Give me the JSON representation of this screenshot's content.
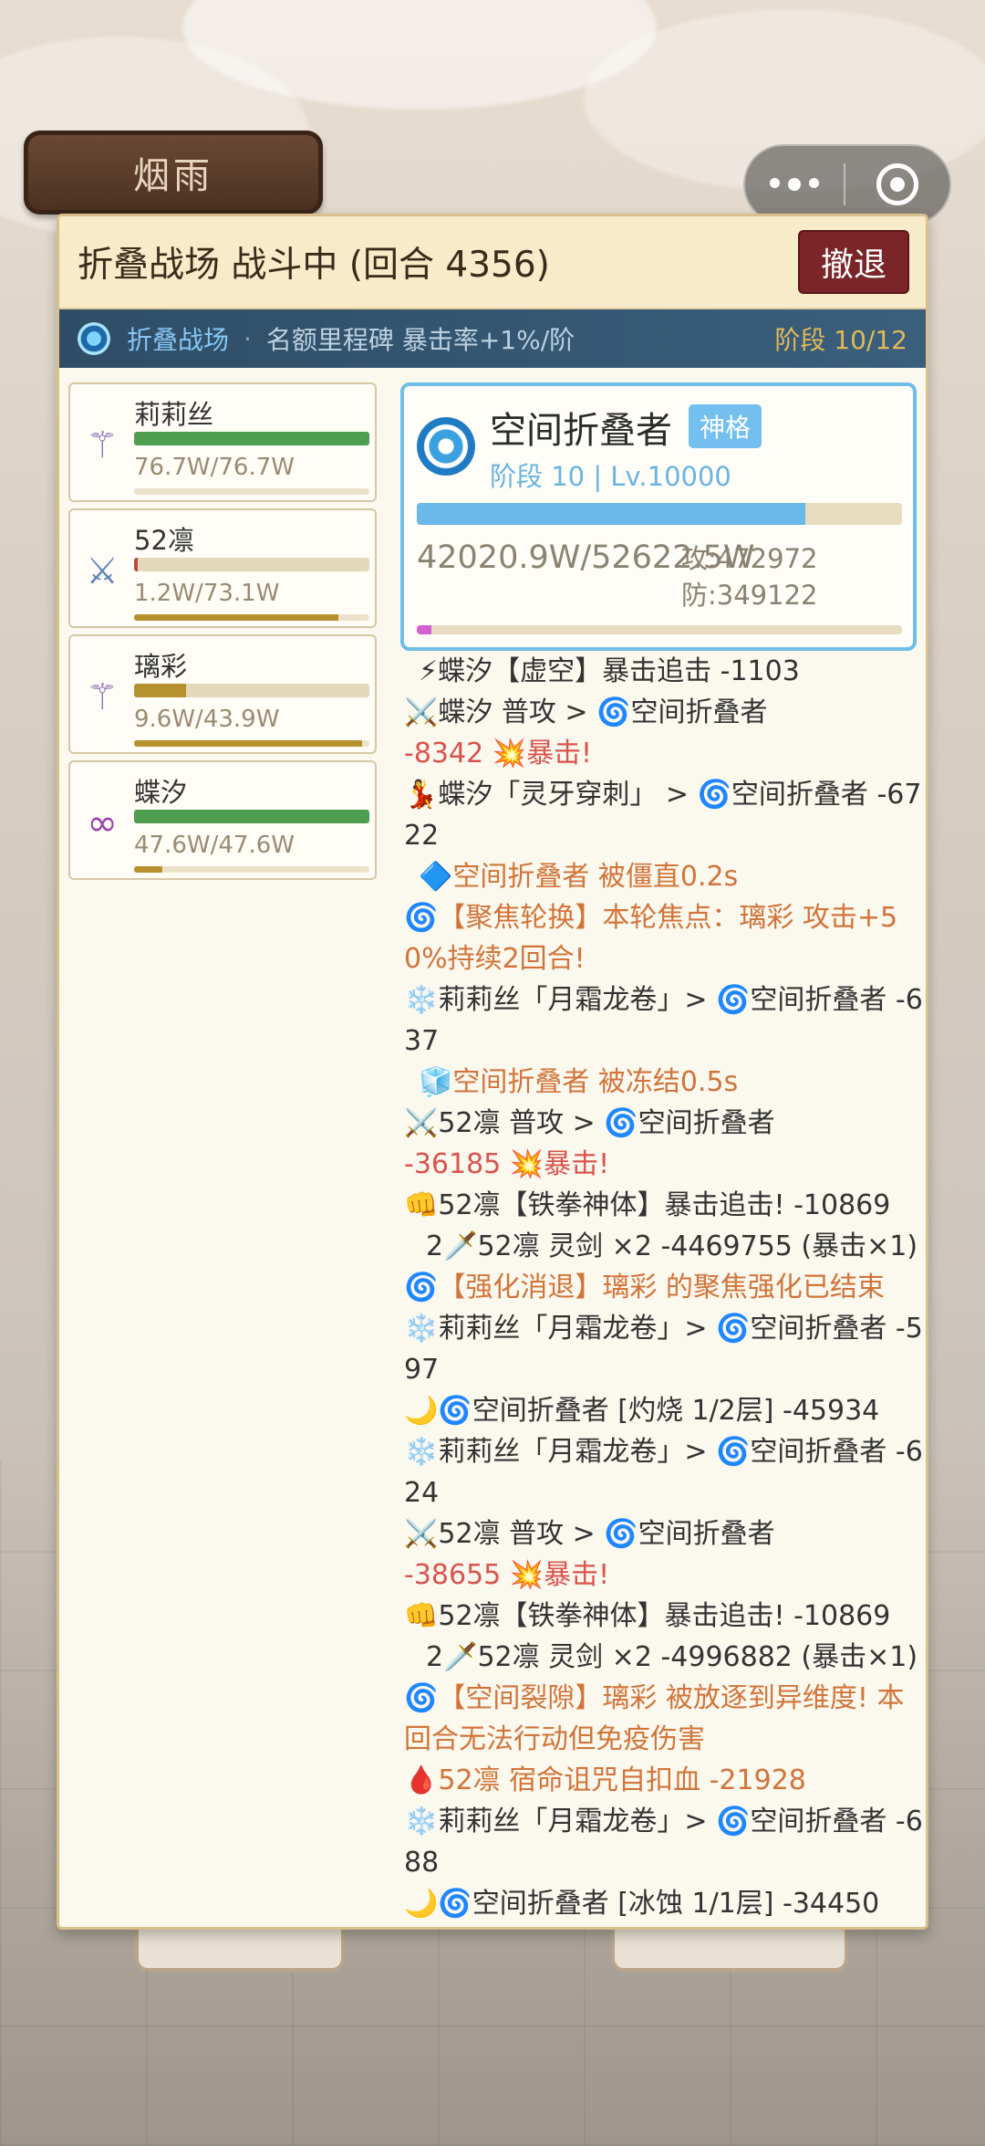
{
  "sign_label": "烟雨",
  "panel": {
    "title": "折叠战场 战斗中 (回合 4356)",
    "retreat_label": "撤退"
  },
  "stage_bar": {
    "name": "折叠战场",
    "separator": "·",
    "buff": "名额里程碑 暴击率+1%/阶",
    "stage": "阶段 10/12"
  },
  "team": [
    {
      "name": "莉莉丝",
      "hp_text": "76.7W/76.7W",
      "hp_fraction": 1.0,
      "energy_fraction": 0.0,
      "icon": "staff-icon",
      "glyph": "⚚",
      "glyph_color": "#8d6fb4"
    },
    {
      "name": "52凛",
      "hp_text": "1.2W/73.1W",
      "hp_fraction": 0.016,
      "energy_fraction": 0.87,
      "icon": "crossed-swords-icon",
      "glyph": "⚔",
      "glyph_color": "#5d86b8"
    },
    {
      "name": "璃彩",
      "hp_text": "9.6W/43.9W",
      "hp_fraction": 0.22,
      "energy_fraction": 0.97,
      "icon": "staff-icon",
      "glyph": "⚚",
      "glyph_color": "#8d6fb4"
    },
    {
      "name": "蝶汐",
      "hp_text": "47.6W/47.6W",
      "hp_fraction": 1.0,
      "energy_fraction": 0.12,
      "icon": "chain-icon",
      "glyph": "∞",
      "glyph_color": "#9a3fb0"
    }
  ],
  "boss": {
    "name": "空间折叠者",
    "tag": "神格",
    "level": "阶段 10 | Lv.10000",
    "hp_text": "42020.9W/52622.5W",
    "hp_fraction": 0.8,
    "atk": "攻:472972",
    "def": "防:349122",
    "shield_fraction": 0.03
  },
  "log": [
    {
      "icon": "⚡",
      "text": "蝶汐【虚空】暴击追击 -1103",
      "cls": "ind"
    },
    {
      "icon": "⚔️",
      "text": "蝶汐 普攻 > 🌀空间折叠者",
      "cls": ""
    },
    {
      "icon": "",
      "text": "-8342 💥暴击!",
      "cls": "red"
    },
    {
      "icon": "💃",
      "text": "蝶汐「灵牙穿刺」 > 🌀空间折叠者 -6722",
      "cls": ""
    },
    {
      "icon": "🔷",
      "text": "空间折叠者 被僵直0.2s",
      "cls": "ind orange"
    },
    {
      "icon": "🌀",
      "text": "【聚焦轮换】本轮焦点：璃彩 攻击+50%持续2回合!",
      "cls": "orange"
    },
    {
      "icon": "❄️",
      "text": "莉莉丝「月霜龙卷」> 🌀空间折叠者 -637",
      "cls": ""
    },
    {
      "icon": "🧊",
      "text": "空间折叠者 被冻结0.5s",
      "cls": "ind orange"
    },
    {
      "icon": "⚔️",
      "text": "52凛 普攻 > 🌀空间折叠者",
      "cls": ""
    },
    {
      "icon": "",
      "text": "-36185 💥暴击!",
      "cls": "red"
    },
    {
      "icon": "👊",
      "text": "52凛【铁拳神体】暴击追击! -10869",
      "cls": ""
    },
    {
      "icon": "",
      "text": "2🗡️52凛 灵剑 ×2 -4469755 (暴击×1)",
      "cls": "ind2"
    },
    {
      "icon": "🌀",
      "text": "【强化消退】璃彩 的聚焦强化已结束",
      "cls": "orange"
    },
    {
      "icon": "❄️",
      "text": "莉莉丝「月霜龙卷」> 🌀空间折叠者 -597",
      "cls": ""
    },
    {
      "icon": "🌙",
      "text": "🌀空间折叠者 [灼烧 1/2层] -45934",
      "cls": ""
    },
    {
      "icon": "❄️",
      "text": "莉莉丝「月霜龙卷」> 🌀空间折叠者 -624",
      "cls": ""
    },
    {
      "icon": "⚔️",
      "text": "52凛 普攻 > 🌀空间折叠者",
      "cls": ""
    },
    {
      "icon": "",
      "text": "-38655 💥暴击!",
      "cls": "red"
    },
    {
      "icon": "👊",
      "text": "52凛【铁拳神体】暴击追击! -10869",
      "cls": ""
    },
    {
      "icon": "",
      "text": "2🗡️52凛 灵剑 ×2 -4996882 (暴击×1)",
      "cls": "ind2"
    },
    {
      "icon": "🌀",
      "text": "【空间裂隙】璃彩 被放逐到异维度! 本回合无法行动但免疫伤害",
      "cls": "orange"
    },
    {
      "icon": "🩸",
      "text": "52凛 宿命诅咒自扣血 -21928",
      "cls": "orange"
    },
    {
      "icon": "❄️",
      "text": "莉莉丝「月霜龙卷」> 🌀空间折叠者 -688",
      "cls": ""
    },
    {
      "icon": "🌙",
      "text": "🌀空间折叠者 [冰蚀 1/1层] -34450",
      "cls": ""
    }
  ]
}
